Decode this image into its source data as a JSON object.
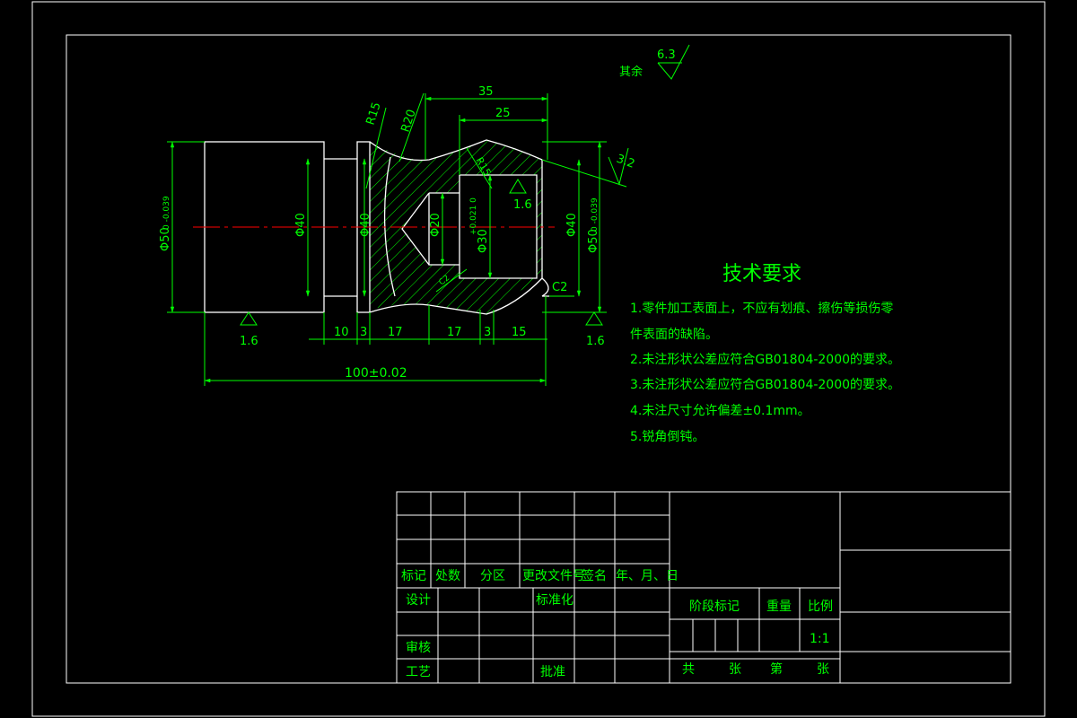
{
  "surface_roughness": {
    "others_label": "其余",
    "others_value": "6.3",
    "right_face": "3.2",
    "bore": "1.6",
    "left_bottom": "1.6",
    "right_bottom": "1.6"
  },
  "dimensions": {
    "d35": "35",
    "d25": "25",
    "r15_top": "R15",
    "r20": "R20",
    "r15_inner": "R15",
    "dia50_left": "Φ50",
    "dia50_left_tol": "0 -0.039",
    "dia40_left": "Φ40",
    "dia40_mid": "Φ40",
    "dia20": "Φ20",
    "dia30": "Φ30",
    "dia30_tol": "+0.021 0",
    "dia40_right": "Φ40",
    "dia50_right": "Φ50",
    "dia50_right_tol": "0 -0.039",
    "chamfer": "C2",
    "chamfer_inner": "C2",
    "len10": "10",
    "len3a": "3",
    "len17a": "17",
    "len17b": "17",
    "len3b": "3",
    "len15": "15",
    "total": "100±0.02"
  },
  "requirements": {
    "title": "技术要求",
    "items": [
      "1.零件加工表面上，不应有划痕、擦伤等损伤零",
      "件表面的缺陷。",
      "2.未注形状公差应符合GB01804-2000的要求。",
      "3.未注形状公差应符合GB01804-2000的要求。",
      "4.未注尺寸允许偏差±0.1mm。",
      "5.锐角倒钝。"
    ]
  },
  "title_block": {
    "biaoji": "标记",
    "chushu": "处数",
    "fenqu": "分区",
    "gaiwen": "更改文件号",
    "qianming": "签名",
    "date": "年、月、日",
    "sheji": "设计",
    "biaozhunhua": "标准化",
    "jieduan": "阶段标记",
    "zhongliang": "重量",
    "bili": "比例",
    "scale": "1:1",
    "shenhe": "审核",
    "gongyi": "工艺",
    "pizhun": "批准",
    "gong": "共",
    "zhang1": "张",
    "di": "第",
    "zhang2": "张"
  },
  "colors": {
    "background": "#000000",
    "annotation": "#00ff00",
    "outline": "#ffffff",
    "centerline": "#ff0000"
  }
}
